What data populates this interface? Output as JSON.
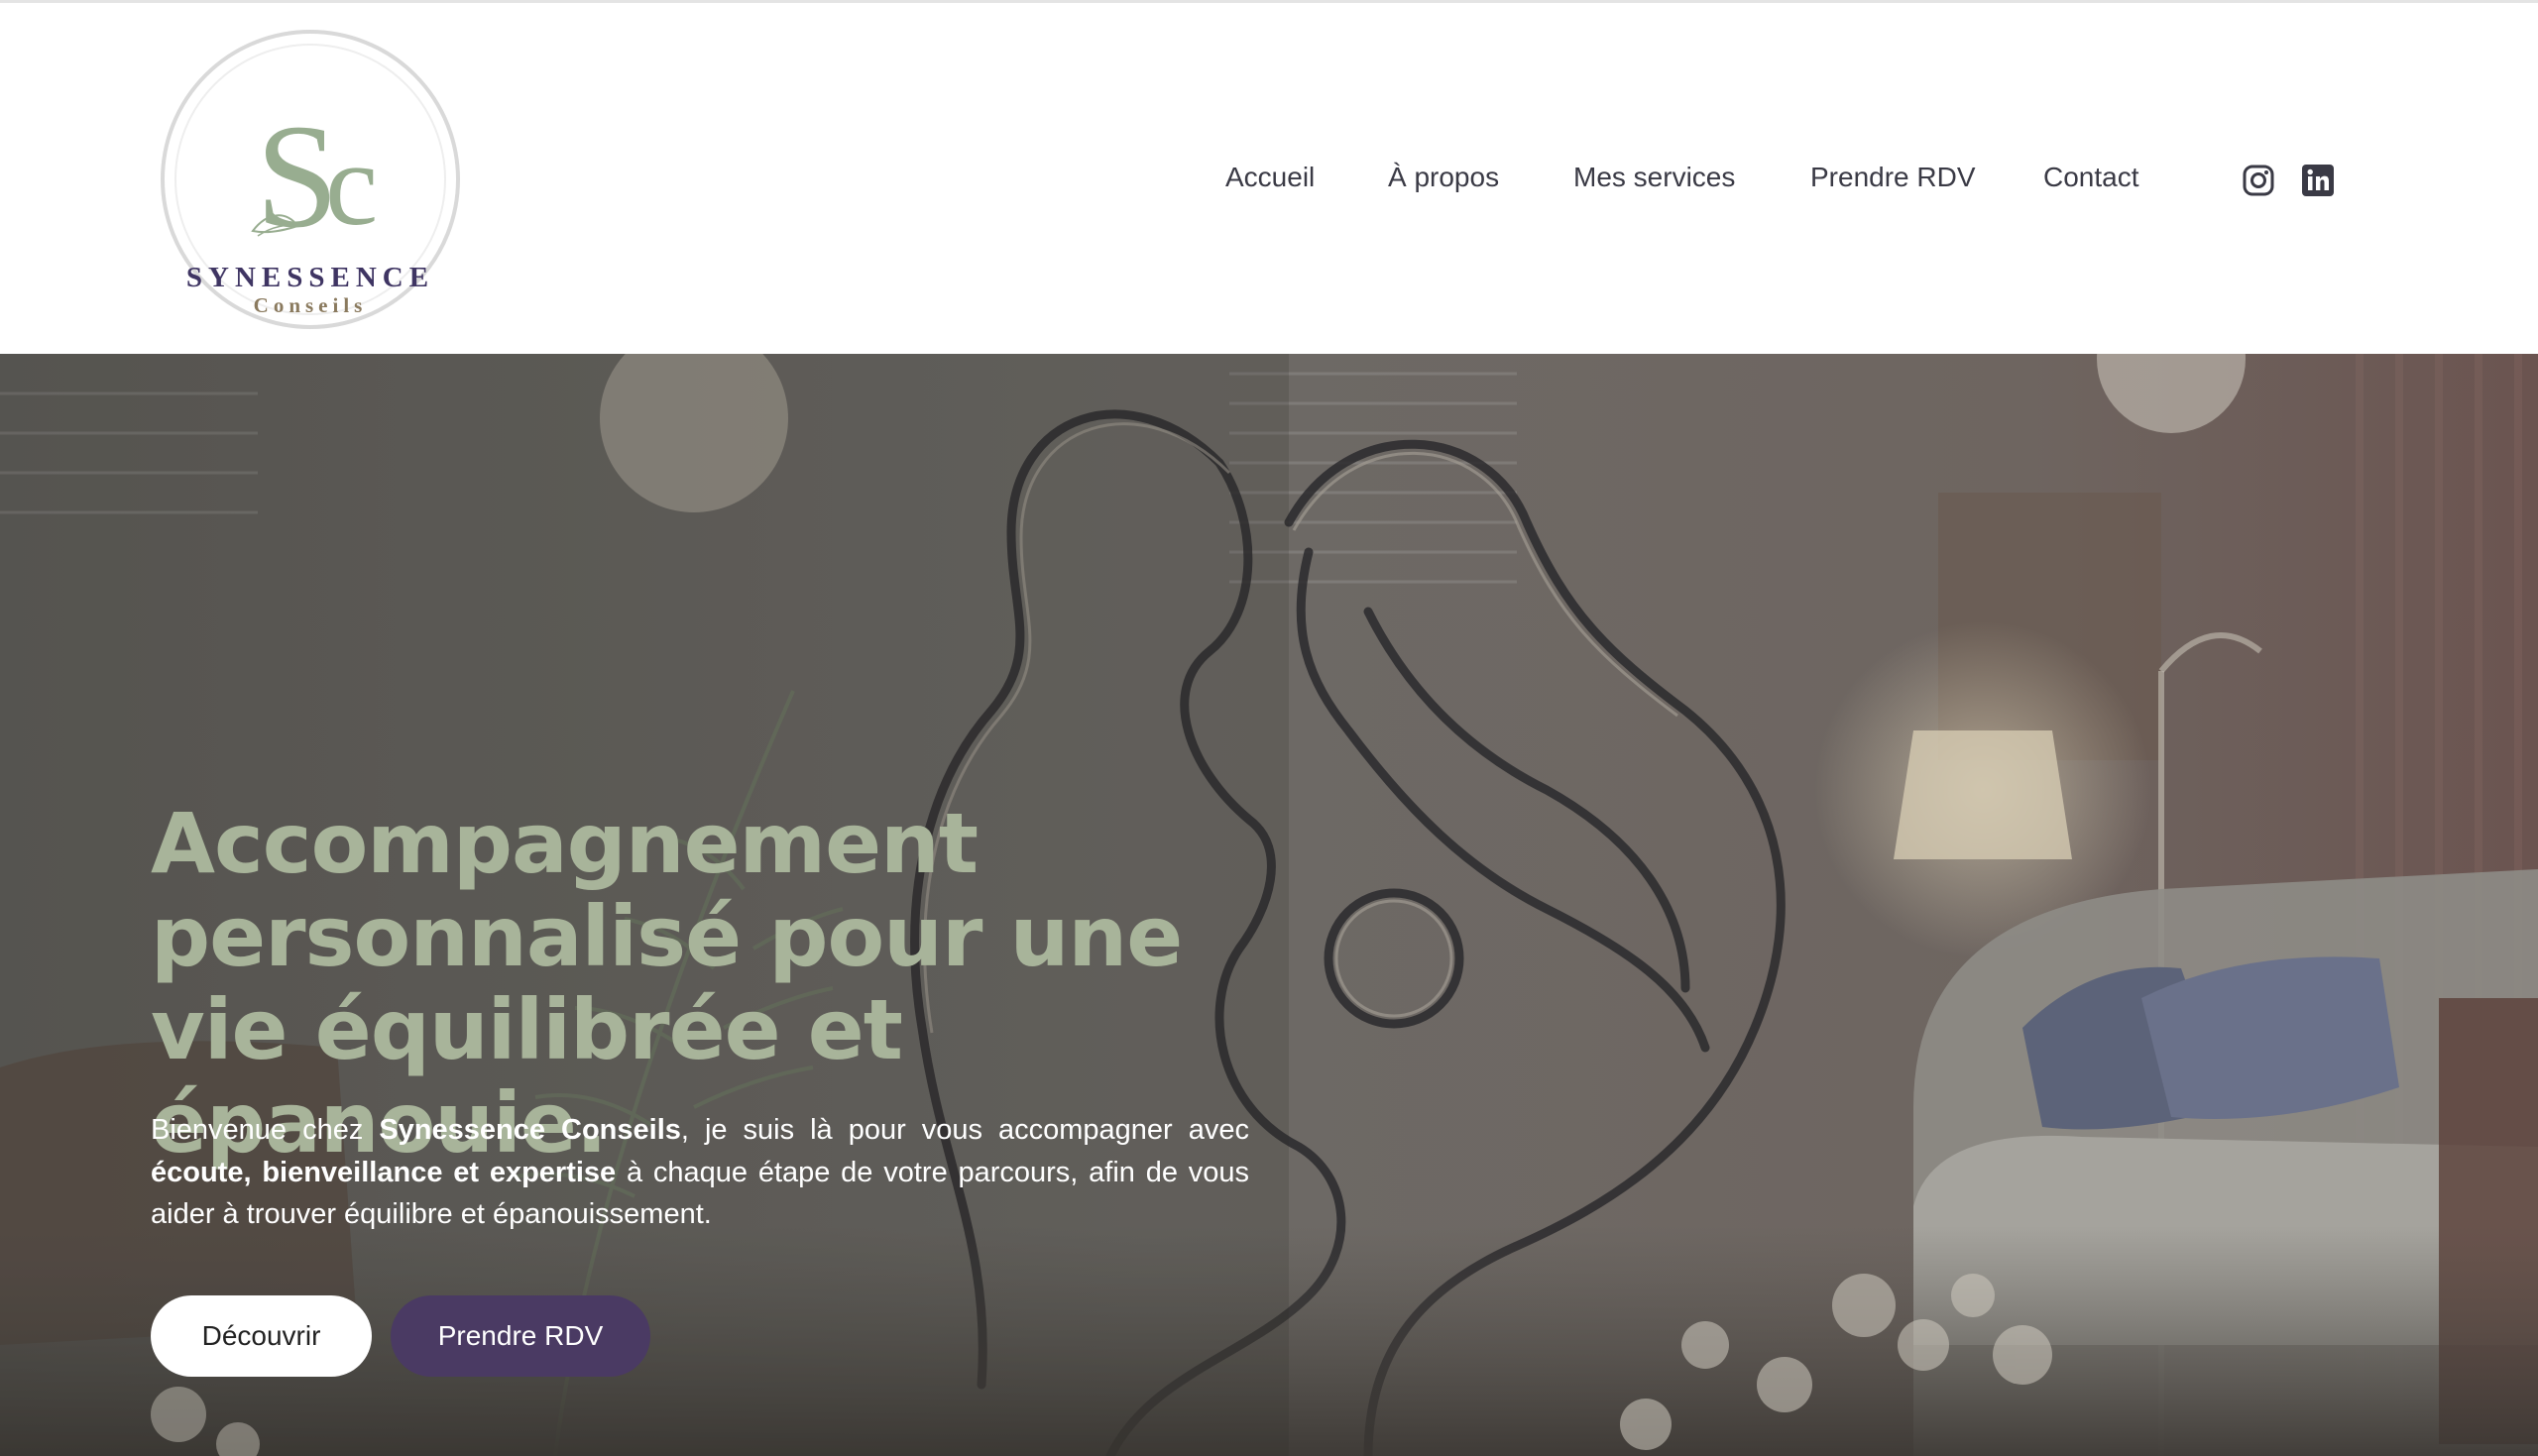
{
  "brand": {
    "name": "SYNESSENCE",
    "subtitle": "Conseils",
    "monogram": "Sc"
  },
  "nav": {
    "items": [
      {
        "label": "Accueil"
      },
      {
        "label": "À propos"
      },
      {
        "label": "Mes services"
      },
      {
        "label": "Prendre RDV"
      },
      {
        "label": "Contact"
      }
    ],
    "social": [
      {
        "icon": "instagram-icon"
      },
      {
        "icon": "linkedin-icon"
      }
    ]
  },
  "hero": {
    "title": "Accompagnement personnalisé pour une vie équilibrée et épanouie.",
    "intro": {
      "p1": "Bienvenue chez ",
      "b1": "Synessence Conseils",
      "p2": ", je suis là pour vous accompagner avec ",
      "b2": "écoute, bienveillance et expertise",
      "p3": " à chaque étape de votre parcours, afin de vous aider à trouver équilibre et épanouissement."
    },
    "buttons": {
      "discover": "Découvrir",
      "book": "Prendre RDV"
    }
  },
  "colors": {
    "title_sage": "#a8b49a",
    "brand_purple": "#3f3563",
    "button_purple": "#4a3a63",
    "nav_text": "#3a3a45"
  }
}
